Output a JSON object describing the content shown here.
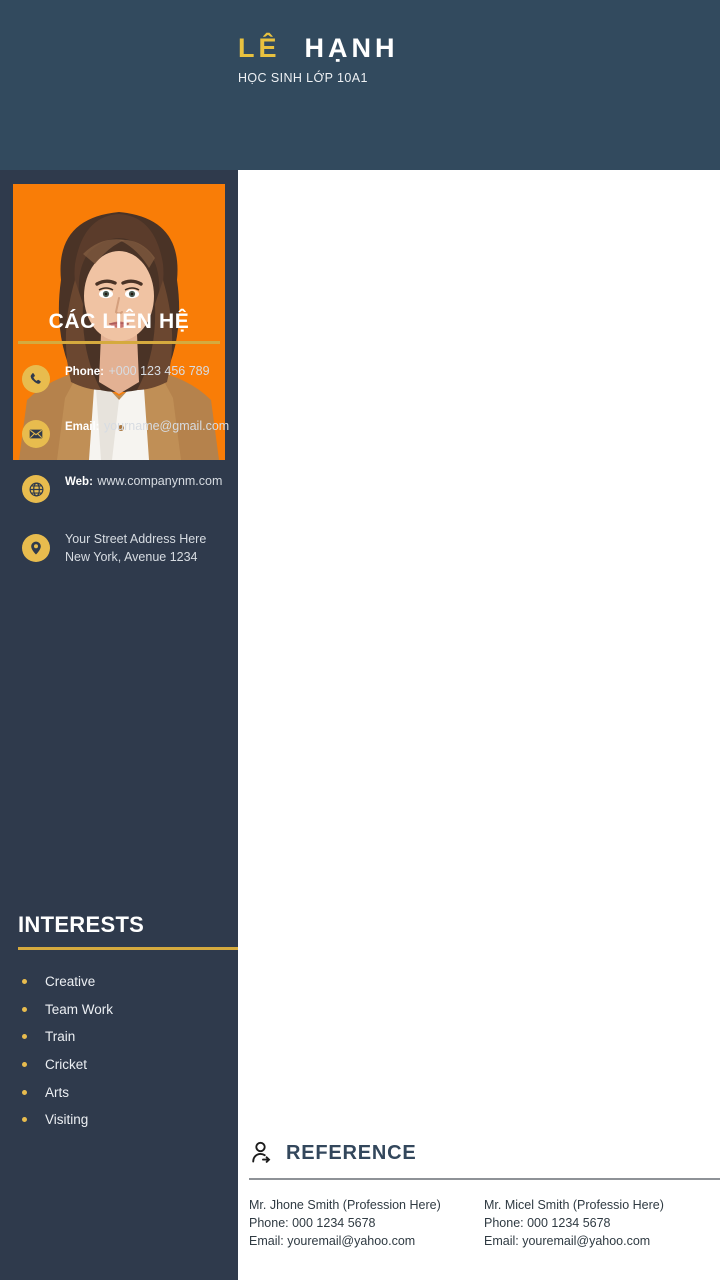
{
  "theme": {
    "header_bg": "#324a5e",
    "sidebar_bg": "#2f3a4c",
    "photo_bg": "#f97d07",
    "accent_gold": "#e8bc4e",
    "rule_gold": "#d5aa3e",
    "name_accent": "#e8c13f",
    "page_bg": "#ffffff",
    "reference_title": "#33475c"
  },
  "header": {
    "name_first": "LÊ",
    "name_last": "HẠNH",
    "subtitle": "HỌC SINH LỚP 10A1"
  },
  "sidebar": {
    "photo": {
      "icon": "portrait-photo",
      "alt": "Portrait photo"
    },
    "contacts": {
      "heading": "CÁC LIÊN HỆ",
      "items": [
        {
          "icon": "phone-icon",
          "label": "Phone:",
          "value": "+000 123 456 789"
        },
        {
          "icon": "envelope-icon",
          "label": "Email:",
          "value": "yourname@gmail.com"
        },
        {
          "icon": "globe-icon",
          "label": "Web:",
          "value": "www.companynm.com"
        }
      ],
      "address": {
        "icon": "location-pin-icon",
        "line1": "Your Street Address Here",
        "line2": "New York, Avenue 1234"
      }
    },
    "interests": {
      "heading": "INTERESTS",
      "items": [
        {
          "label": "Creative"
        },
        {
          "label": "Team Work"
        },
        {
          "label": "Train"
        },
        {
          "label": "Cricket"
        },
        {
          "label": "Arts"
        },
        {
          "label": "Visiting"
        }
      ]
    }
  },
  "reference": {
    "icon": "person-share-icon",
    "heading": "REFERENCE",
    "entries": [
      {
        "name": "Mr. Jhone Smith (Profession Here)",
        "phone": "Phone: 000 1234 5678",
        "email": "Email: youremail@yahoo.com"
      },
      {
        "name": "Mr. Micel Smith (Professio Here)",
        "phone": "Phone: 000 1234 5678",
        "email": "Email: youremail@yahoo.com"
      }
    ]
  }
}
